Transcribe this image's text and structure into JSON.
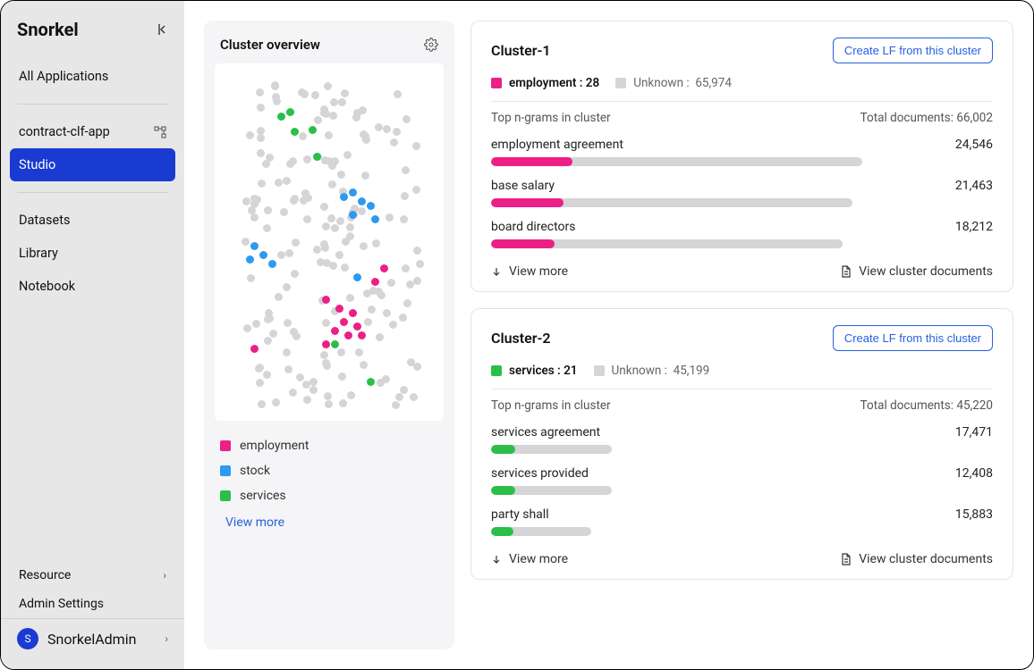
{
  "brand": "Snorkel",
  "sidebar": {
    "all_apps": "All Applications",
    "app_name": "contract-clf-app",
    "studio": "Studio",
    "datasets": "Datasets",
    "library": "Library",
    "notebook": "Notebook",
    "resource": "Resource",
    "admin": "Admin Settings",
    "user": "SnorkelAdmin",
    "user_initial": "S"
  },
  "overview": {
    "title": "Cluster overview",
    "legend": {
      "employment": "employment",
      "stock": "stock",
      "services": "services"
    },
    "view_more": "View more"
  },
  "clusters": [
    {
      "name": "Cluster-1",
      "create_lf": "Create LF from this cluster",
      "primary_label": "employment",
      "primary_count": "28",
      "unknown_label": "Unknown",
      "unknown_count": "65,974",
      "ngram_header": "Top n-grams in cluster",
      "total_docs_label": "Total documents:",
      "total_docs": "66,002",
      "color": "pink",
      "ngrams": [
        {
          "label": "employment agreement",
          "value": "24,546",
          "bar_percent": 74,
          "fill_percent": 22
        },
        {
          "label": "base salary",
          "value": "21,463",
          "bar_percent": 72,
          "fill_percent": 20
        },
        {
          "label": "board directors",
          "value": "18,212",
          "bar_percent": 70,
          "fill_percent": 18
        }
      ],
      "view_more": "View more",
      "view_docs": "View cluster documents"
    },
    {
      "name": "Cluster-2",
      "create_lf": "Create LF from this cluster",
      "primary_label": "services",
      "primary_count": "21",
      "unknown_label": "Unknown",
      "unknown_count": "45,199",
      "ngram_header": "Top n-grams in cluster",
      "total_docs_label": "Total documents:",
      "total_docs": "45,220",
      "color": "green",
      "ngrams": [
        {
          "label": "services agreement",
          "value": "17,471",
          "bar_percent": 24,
          "fill_percent": 20
        },
        {
          "label": "services provided",
          "value": "12,408",
          "bar_percent": 24,
          "fill_percent": 20
        },
        {
          "label": "party shall",
          "value": "15,883",
          "bar_percent": 20,
          "fill_percent": 22
        }
      ],
      "view_more": "View more",
      "view_docs": "View cluster documents"
    }
  ]
}
